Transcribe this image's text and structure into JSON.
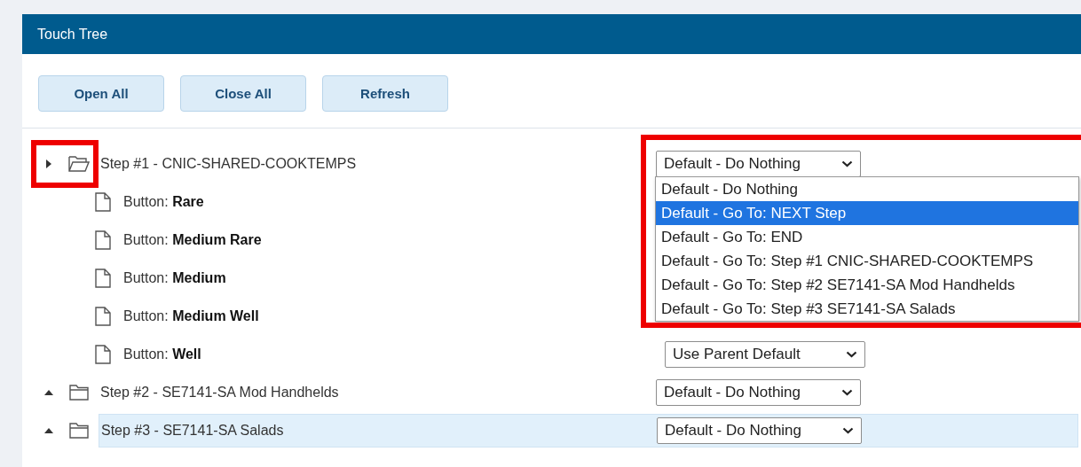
{
  "panel": {
    "title": "Touch Tree"
  },
  "toolbar": [
    "Open All",
    "Close All",
    "Refresh"
  ],
  "tree": [
    {
      "kind": "step",
      "label": "Step #1 - CNIC-SHARED-COOKTEMPS",
      "expanded": true,
      "selected": false,
      "action": "Default - Do Nothing",
      "options": [
        {
          "label": "Default - Do Nothing",
          "selected": false
        },
        {
          "label": "Default - Go To: NEXT Step",
          "selected": true
        },
        {
          "label": "Default - Go To: END",
          "selected": false
        },
        {
          "label": "Default - Go To: Step #1 CNIC-SHARED-COOKTEMPS",
          "selected": false
        },
        {
          "label": "Default - Go To: Step #2 SE7141-SA Mod Handhelds",
          "selected": false
        },
        {
          "label": "Default - Go To: Step #3 SE7141-SA Salads",
          "selected": false
        }
      ],
      "children": [
        {
          "kind": "button",
          "label": "Button: **Rare**"
        },
        {
          "kind": "button",
          "label": "Button: **Medium Rare**"
        },
        {
          "kind": "button",
          "label": "Button: **Medium**"
        },
        {
          "kind": "button",
          "label": "Button: **Medium Well**"
        },
        {
          "kind": "button",
          "label": "Button: **Well**",
          "action": "Use Parent Default"
        }
      ]
    },
    {
      "kind": "step",
      "label": "Step #2 - SE7141-SA Mod Handhelds",
      "expanded": false,
      "selected": false,
      "action": "Default - Do Nothing"
    },
    {
      "kind": "step",
      "label": "Step #3 - SE7141-SA Salads",
      "expanded": false,
      "selected": true,
      "action": "Default - Do Nothing"
    }
  ]
}
